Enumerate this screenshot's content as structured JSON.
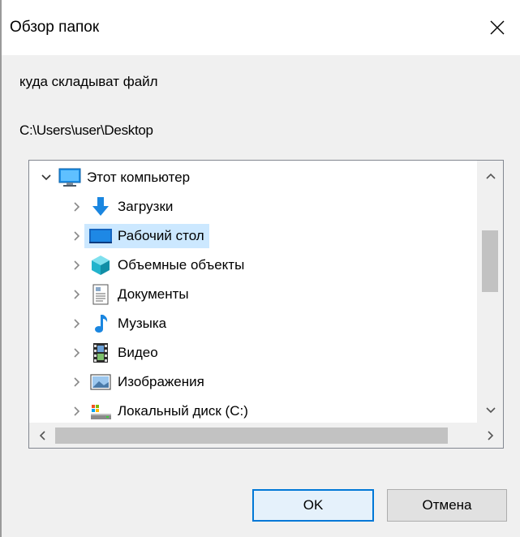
{
  "window": {
    "title": "Обзор папок",
    "close_icon": "close-icon"
  },
  "instruction": "куда складыват файл",
  "selected_path": "C:\\Users\\user\\Desktop",
  "tree": {
    "root": {
      "label": "Этот компьютер",
      "icon": "computer-icon",
      "expanded": true
    },
    "items": [
      {
        "label": "Загрузки",
        "icon": "downloads-icon",
        "selected": false
      },
      {
        "label": "Рабочий стол",
        "icon": "desktop-icon",
        "selected": true
      },
      {
        "label": "Объемные объекты",
        "icon": "3d-objects-icon",
        "selected": false
      },
      {
        "label": "Документы",
        "icon": "documents-icon",
        "selected": false
      },
      {
        "label": "Музыка",
        "icon": "music-icon",
        "selected": false
      },
      {
        "label": "Видео",
        "icon": "video-icon",
        "selected": false
      },
      {
        "label": "Изображения",
        "icon": "pictures-icon",
        "selected": false
      },
      {
        "label": "Локальный диск (C:)",
        "icon": "local-disk-icon",
        "selected": false
      }
    ]
  },
  "buttons": {
    "ok": "OK",
    "cancel": "Отмена"
  },
  "colors": {
    "selection": "#cce8ff",
    "accent": "#0078d7",
    "dialog_bg": "#f0f0f0"
  }
}
